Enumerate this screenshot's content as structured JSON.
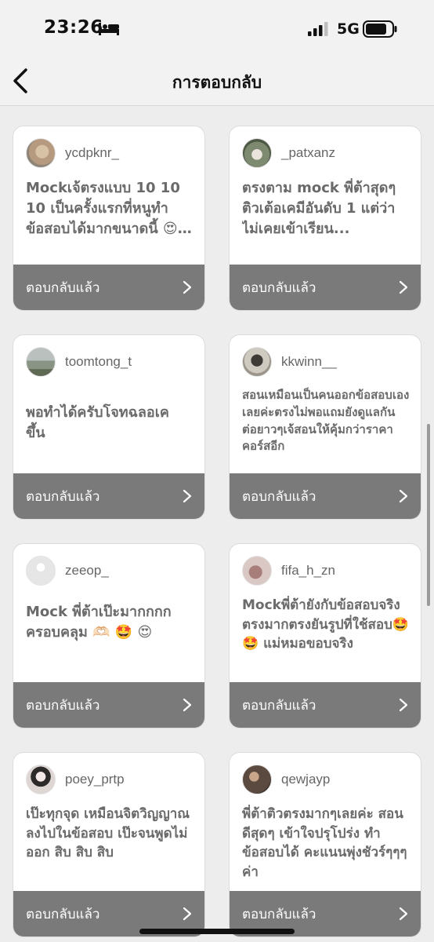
{
  "status_bar": {
    "time": "23:26",
    "network": "5G"
  },
  "header": {
    "title": "การตอบกลับ"
  },
  "cards": [
    {
      "username": "ycdpknr_",
      "review": "Mockเจ้ตรงแบบ 10 10 10  เป็นครั้งแรกที่หนูทำข้อสอบได้มากขนาดนี้ 😍 💕",
      "footer": "ตอบกลับแล้ว"
    },
    {
      "username": "_patxanz",
      "review": "ตรงตาม mock พี่ต้าสุดๆ ติวเต้อเคมีอันดับ 1 แต่ว่า ไม่เคยเข้าเรียน...",
      "footer": "ตอบกลับแล้ว"
    },
    {
      "username": "toomtong_t",
      "review": "พอทำได้ครับโจทฉลอเคขึ้น",
      "footer": "ตอบกลับแล้ว"
    },
    {
      "username": "kkwinn__",
      "review": "สอนเหมือนเป็นคนออกข้อสอบเองเลยค่ะตรงไม่พอแถมยังดูแลกันต่อยาวๆเจ้สอนให้คุ้มกว่าราคาคอร์สอีก",
      "footer": "ตอบกลับแล้ว"
    },
    {
      "username": "zeeop_",
      "review": "Mock พี่ต้าเป๊ะมากกกก ครอบคลุม  🫶🏻 🤩 😍",
      "footer": "ตอบกลับแล้ว"
    },
    {
      "username": "fifa_h_zn",
      "review": "Mockพี่ต้ายังกับข้อสอบจริง ตรงมากตรงยันรูปที่ใช้สอบ🤩 🤩  แม่หมอขอบจริง",
      "footer": "ตอบกลับแล้ว"
    },
    {
      "username": "poey_prtp",
      "review": "เป๊ะทุกจุด เหมือนจิตวิญญาณลงไปในข้อสอบ เป๊ะจนพูดไม่ออก สิบ สิบ สิบ",
      "footer": "ตอบกลับแล้ว"
    },
    {
      "username": "qewjayp",
      "review": "พี่ต้าติวตรงมากๆเลยค่ะ สอนดีสุดๆ เข้าใจปรุโปร่ง ทำข้อสอบได้ คะแนนพุ่งชัวร์ๆๆๆค่า",
      "footer": "ตอบกลับแล้ว"
    }
  ],
  "colors": {
    "footer_bg": "#7a7a7a",
    "card_bg": "#ffffff",
    "page_bg": "#ededed",
    "review_text": "#6a6a6a"
  },
  "icons": {
    "back": "chevron-left-icon",
    "card_action": "chevron-right-icon",
    "sleep_focus": "bed-icon",
    "signal": "cellular-signal-icon",
    "battery": "battery-icon"
  }
}
